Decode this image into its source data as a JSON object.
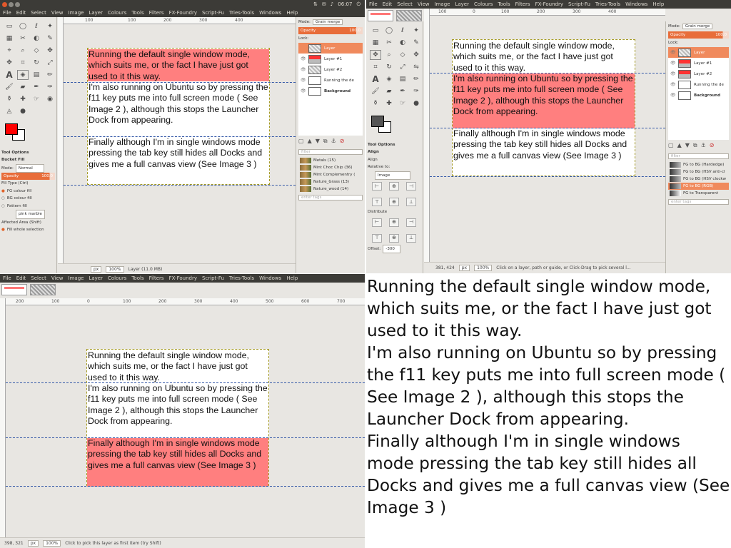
{
  "menus": [
    "File",
    "Edit",
    "Select",
    "View",
    "Image",
    "Layer",
    "Colours",
    "Tools",
    "Filters",
    "FX-Foundry",
    "Script-Fu",
    "Tries-Tools",
    "Windows",
    "Help"
  ],
  "clock": "06:07",
  "paragraphs": [
    "Running the default single window mode, which suits me, or the fact I have just got used to it this way.",
    "I'm also running on Ubuntu so by pressing the f11 key puts me into full screen mode ( See Image 2 ), although this stops the Launcher Dock from appearing.",
    "Finally although I'm in single windows mode pressing the tab key still hides all Docks and gives me a full canvas view (See Image 3 )"
  ],
  "ruler_ticks": [
    "100",
    "0",
    "100",
    "200",
    "300",
    "400",
    "500",
    "600"
  ],
  "ruler_ticks_wide": [
    "200",
    "100",
    "0",
    "100",
    "200",
    "300",
    "400",
    "500",
    "600",
    "700"
  ],
  "tool_options": {
    "header": "Tool Options",
    "tool": "Bucket Fill",
    "mode_label": "Mode:",
    "mode_value": "Normal",
    "opacity_label": "Opacity",
    "opacity_value": "100.0",
    "fill_type": "Fill Type (Ctrl)",
    "fg_fill": "FG colour fill",
    "bg_fill": "BG colour fill",
    "pattern_fill": "Pattern fill",
    "pattern_name": "pink marble",
    "affected_area": "Affected Area (Shift)",
    "fill_whole": "Fill whole selection"
  },
  "align_options": {
    "header": "Tool Options",
    "tool": "Align",
    "sub": "Align",
    "relative_label": "Relative to:",
    "relative_value": "Image",
    "distribute": "Distribute",
    "offset_label": "Offset:",
    "offset_value": "-300"
  },
  "layers_dock": {
    "mode_label": "Mode:",
    "mode_value": "Grain merge",
    "opacity_label": "Opacity",
    "opacity_value": "100.0",
    "lock_label": "Lock:",
    "layers": [
      "Layer",
      "Layer #1",
      "Layer #2",
      "Running the de",
      "Background"
    ]
  },
  "brushes": [
    "Metals (15)",
    "Mint Choc Chip (36)",
    "Mint Complementry (",
    "Nature_Grass (13)",
    "Nature_wood (14)"
  ],
  "gradients": [
    "FG to BG (Hardedge)",
    "FG to BG (HSV anti-cl",
    "FG to BG (HSV clockw",
    "FG to BG (RGB)",
    "FG to Transparent"
  ],
  "filter_placeholder": "filter",
  "tags_placeholder": "enter tags",
  "status": {
    "pane1_units": "px",
    "pane1_zoom": "100%",
    "pane1_msg": "Layer (11.0 MB)",
    "pane2_coords": "381, 424",
    "pane2_units": "px",
    "pane2_zoom": "100%",
    "pane2_msg": "Click on a layer, path or guide, or Click-Drag to pick several l...",
    "pane3_coords": "398, 321",
    "pane3_units": "px",
    "pane3_zoom": "100%",
    "pane3_msg": "Click to pick this layer as first item (try Shift)"
  }
}
